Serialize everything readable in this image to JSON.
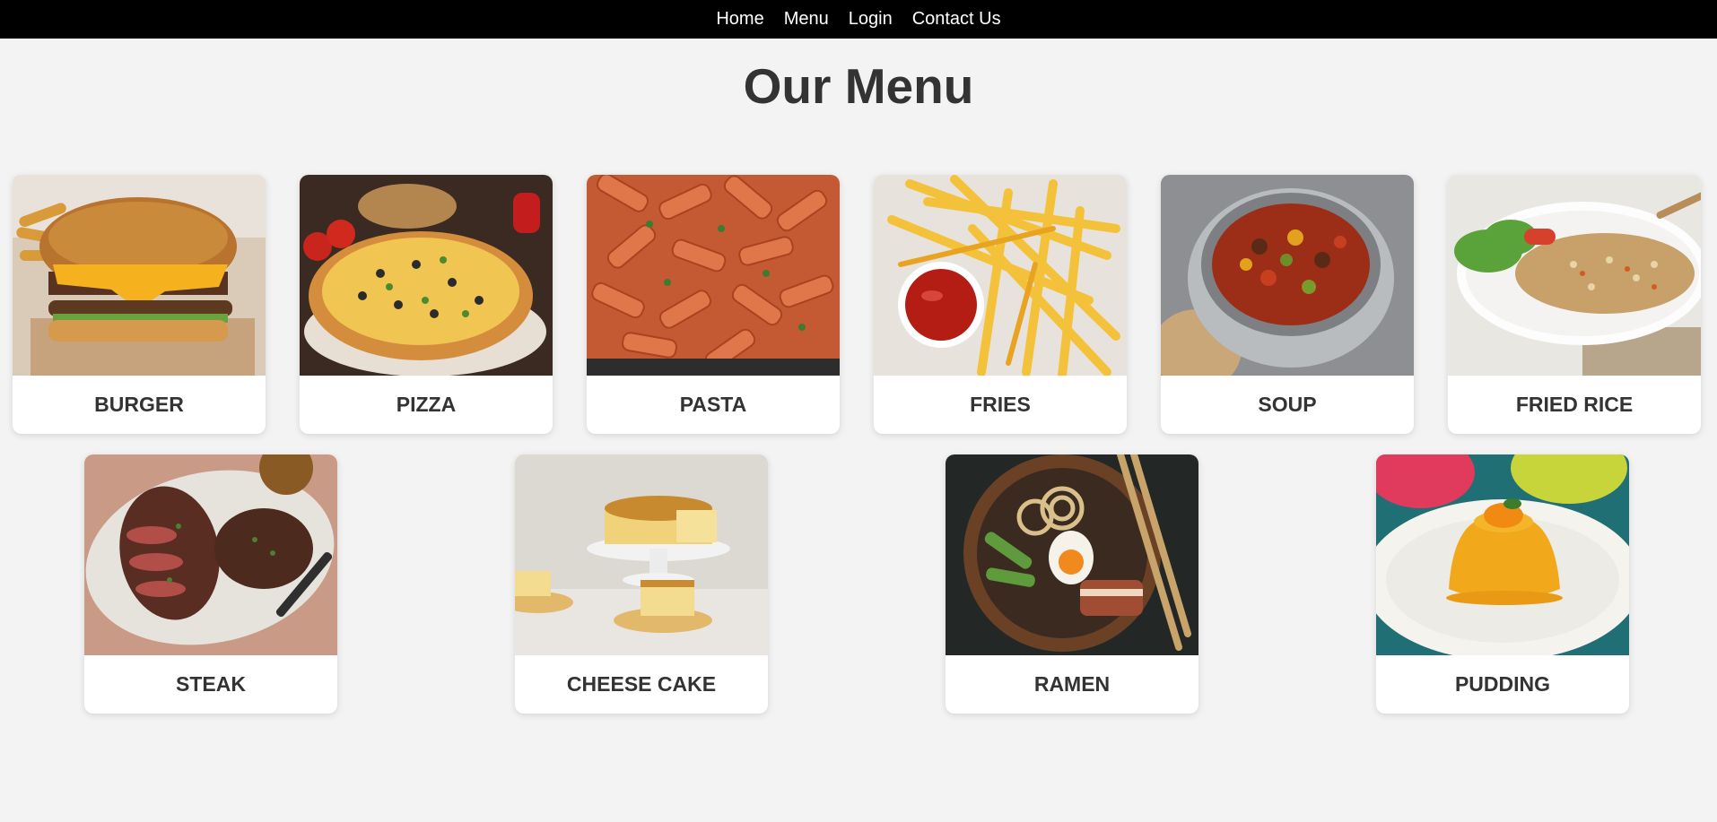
{
  "nav": {
    "home": "Home",
    "menu": "Menu",
    "login": "Login",
    "contact": "Contact Us"
  },
  "page": {
    "title": "Our Menu"
  },
  "menu_items": [
    {
      "name": "BURGER"
    },
    {
      "name": "PIZZA"
    },
    {
      "name": "PASTA"
    },
    {
      "name": "FRIES"
    },
    {
      "name": "SOUP"
    },
    {
      "name": "FRIED RICE"
    },
    {
      "name": "STEAK"
    },
    {
      "name": "CHEESE CAKE"
    },
    {
      "name": "RAMEN"
    },
    {
      "name": "PUDDING"
    }
  ]
}
